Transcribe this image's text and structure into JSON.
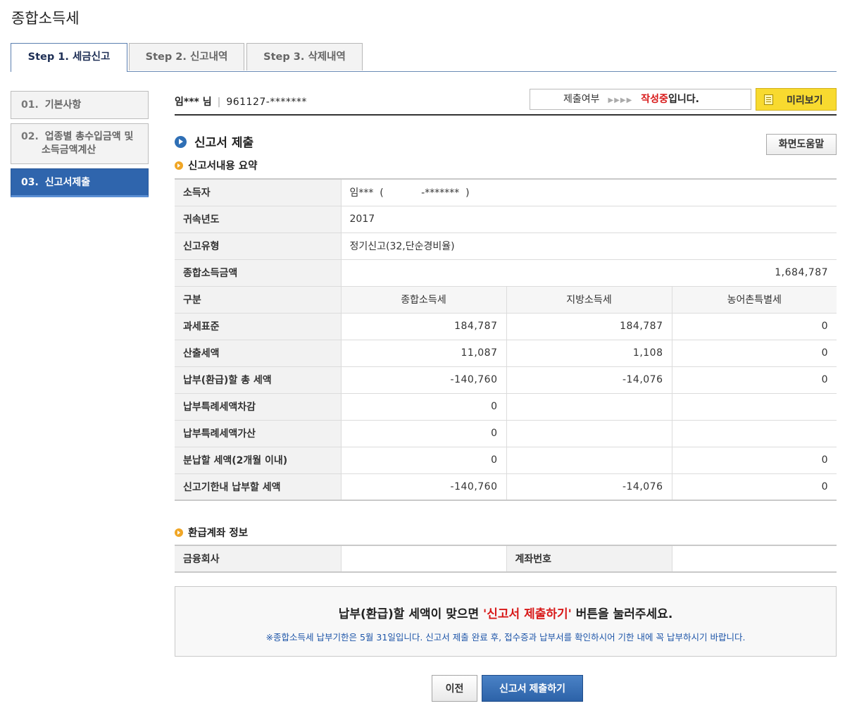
{
  "page": {
    "title": "종합소득세"
  },
  "tabs": [
    {
      "label": "Step 1. 세금신고",
      "active": true
    },
    {
      "label": "Step 2. 신고내역",
      "active": false
    },
    {
      "label": "Step 3. 삭제내역",
      "active": false
    }
  ],
  "sidebar": {
    "items": [
      {
        "num": "01.",
        "label": "기본사항"
      },
      {
        "num": "02.",
        "label": "업종별 총수입금액 및",
        "label2": "소득금액계산"
      },
      {
        "num": "03.",
        "label": "신고서제출",
        "active": true
      }
    ]
  },
  "user": {
    "name": "임*** 님",
    "separator": "|",
    "rrn": "961127-*******"
  },
  "status": {
    "label": "제출여부",
    "arrows": "▶▶▶▶",
    "state_red": "작성중",
    "state_suffix": "입니다."
  },
  "preview_button": {
    "label": "미리보기"
  },
  "section": {
    "title": "신고서 제출",
    "help_button": "화면도움말"
  },
  "summary": {
    "title": "신고서내용 요약",
    "income_earner": {
      "label": "소득자",
      "value": "임***  (            -*******  )"
    },
    "year": {
      "label": "귀속년도",
      "value": "2017"
    },
    "report_type": {
      "label": "신고유형",
      "value": "정기신고(32,단순경비율)"
    },
    "total_income": {
      "label": "종합소득금액",
      "value": "1,684,787"
    },
    "columns": {
      "label": "구분",
      "col1": "종합소득세",
      "col2": "지방소득세",
      "col3": "농어촌특별세"
    },
    "rows": [
      {
        "label": "과세표준",
        "v1": "184,787",
        "v2": "184,787",
        "v3": "0"
      },
      {
        "label": "산출세액",
        "v1": "11,087",
        "v2": "1,108",
        "v3": "0"
      },
      {
        "label": "납부(환급)할 총 세액",
        "v1": "-140,760",
        "v2": "-14,076",
        "v3": "0"
      },
      {
        "label": "납부특례세액차감",
        "v1": "0",
        "v2": "",
        "v3": ""
      },
      {
        "label": "납부특례세액가산",
        "v1": "0",
        "v2": "",
        "v3": ""
      },
      {
        "label": "분납할 세액(2개월 이내)",
        "v1": "0",
        "v2": "",
        "v3": "0"
      },
      {
        "label": "신고기한내 납부할 세액",
        "v1": "-140,760",
        "v2": "-14,076",
        "v3": "0"
      }
    ]
  },
  "refund": {
    "title": "환급계좌 정보",
    "bank_label": "금융회사",
    "bank_value": "",
    "account_label": "계좌번호",
    "account_value": ""
  },
  "notice": {
    "main_prefix": "납부(환급)할 세액이 맞으면 ",
    "main_red": "'신고서 제출하기'",
    "main_suffix": " 버튼을 눌러주세요.",
    "sub": "※종합소득세 납부기한은 5월 31일입니다. 신고서 제출 완료 후, 접수증과 납부서를 확인하시어 기한 내에 꼭 납부하시기 바랍니다."
  },
  "buttons": {
    "prev": "이전",
    "submit": "신고서 제출하기"
  },
  "colors": {
    "accent": "#2f65ad",
    "highlight": "#d81919",
    "preview": "#f8da2f"
  }
}
